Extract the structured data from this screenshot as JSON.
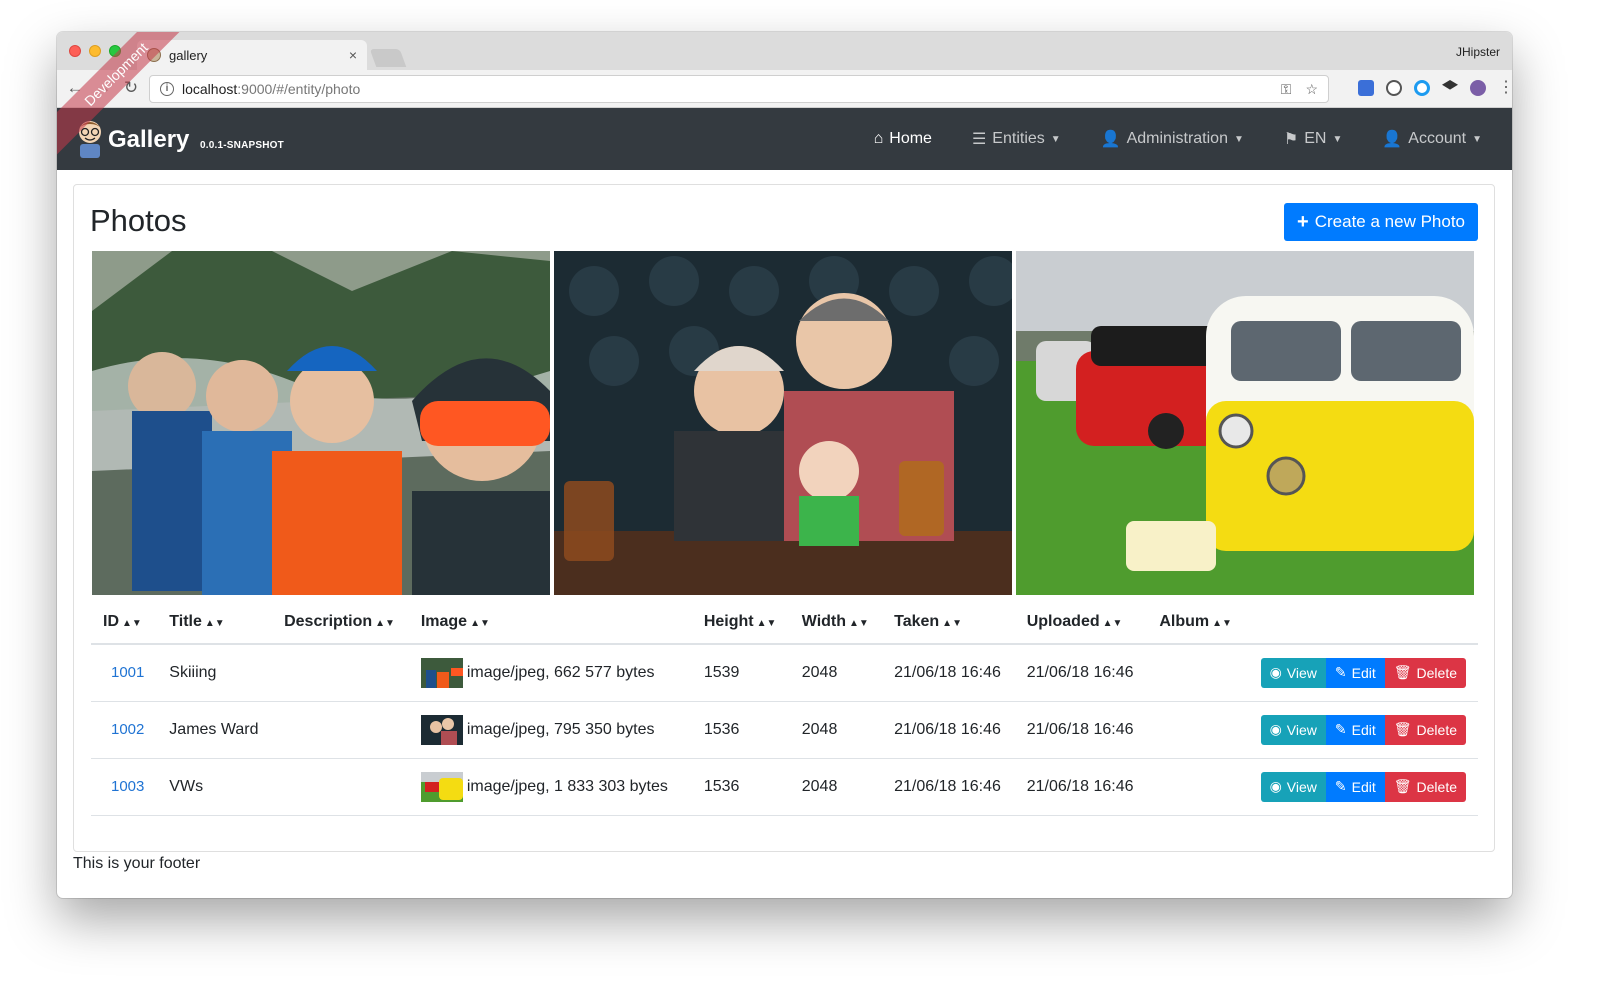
{
  "browser": {
    "tab_title": "gallery",
    "tab_close": "×",
    "profile_name": "JHipster",
    "url_host": "localhost",
    "url_path": ":9000/#/entity/photo"
  },
  "navbar": {
    "brand": "Gallery",
    "version": "0.0.1-SNAPSHOT",
    "ribbon": "Development",
    "items": [
      {
        "label": "Home",
        "icon": "home-icon"
      },
      {
        "label": "Entities",
        "icon": "th-list-icon"
      },
      {
        "label": "Administration",
        "icon": "user-plus-icon"
      },
      {
        "label": "EN",
        "icon": "flag-icon"
      },
      {
        "label": "Account",
        "icon": "user-icon"
      }
    ]
  },
  "page": {
    "title": "Photos",
    "create_label": "Create a new Photo"
  },
  "table": {
    "headers": [
      "ID",
      "Title",
      "Description",
      "Image",
      "Height",
      "Width",
      "Taken",
      "Uploaded",
      "Album"
    ],
    "rows": [
      {
        "id": "1001",
        "title": "Skiiing",
        "description": "",
        "image": "image/jpeg, 662 577 bytes",
        "height": "1539",
        "width": "2048",
        "taken": "21/06/18 16:46",
        "uploaded": "21/06/18 16:46",
        "album": ""
      },
      {
        "id": "1002",
        "title": "James Ward",
        "description": "",
        "image": "image/jpeg, 795 350 bytes",
        "height": "1536",
        "width": "2048",
        "taken": "21/06/18 16:46",
        "uploaded": "21/06/18 16:46",
        "album": ""
      },
      {
        "id": "1003",
        "title": "VWs",
        "description": "",
        "image": "image/jpeg, 1 833 303 bytes",
        "height": "1536",
        "width": "2048",
        "taken": "21/06/18 16:46",
        "uploaded": "21/06/18 16:46",
        "album": ""
      }
    ],
    "actions": {
      "view": "View",
      "edit": "Edit",
      "delete": "Delete"
    }
  },
  "footer": "This is your footer",
  "colors": {
    "navbar": "#343a40",
    "primary": "#007bff",
    "info": "#17a2b8",
    "danger": "#dc3545",
    "link": "#1f73d3"
  }
}
